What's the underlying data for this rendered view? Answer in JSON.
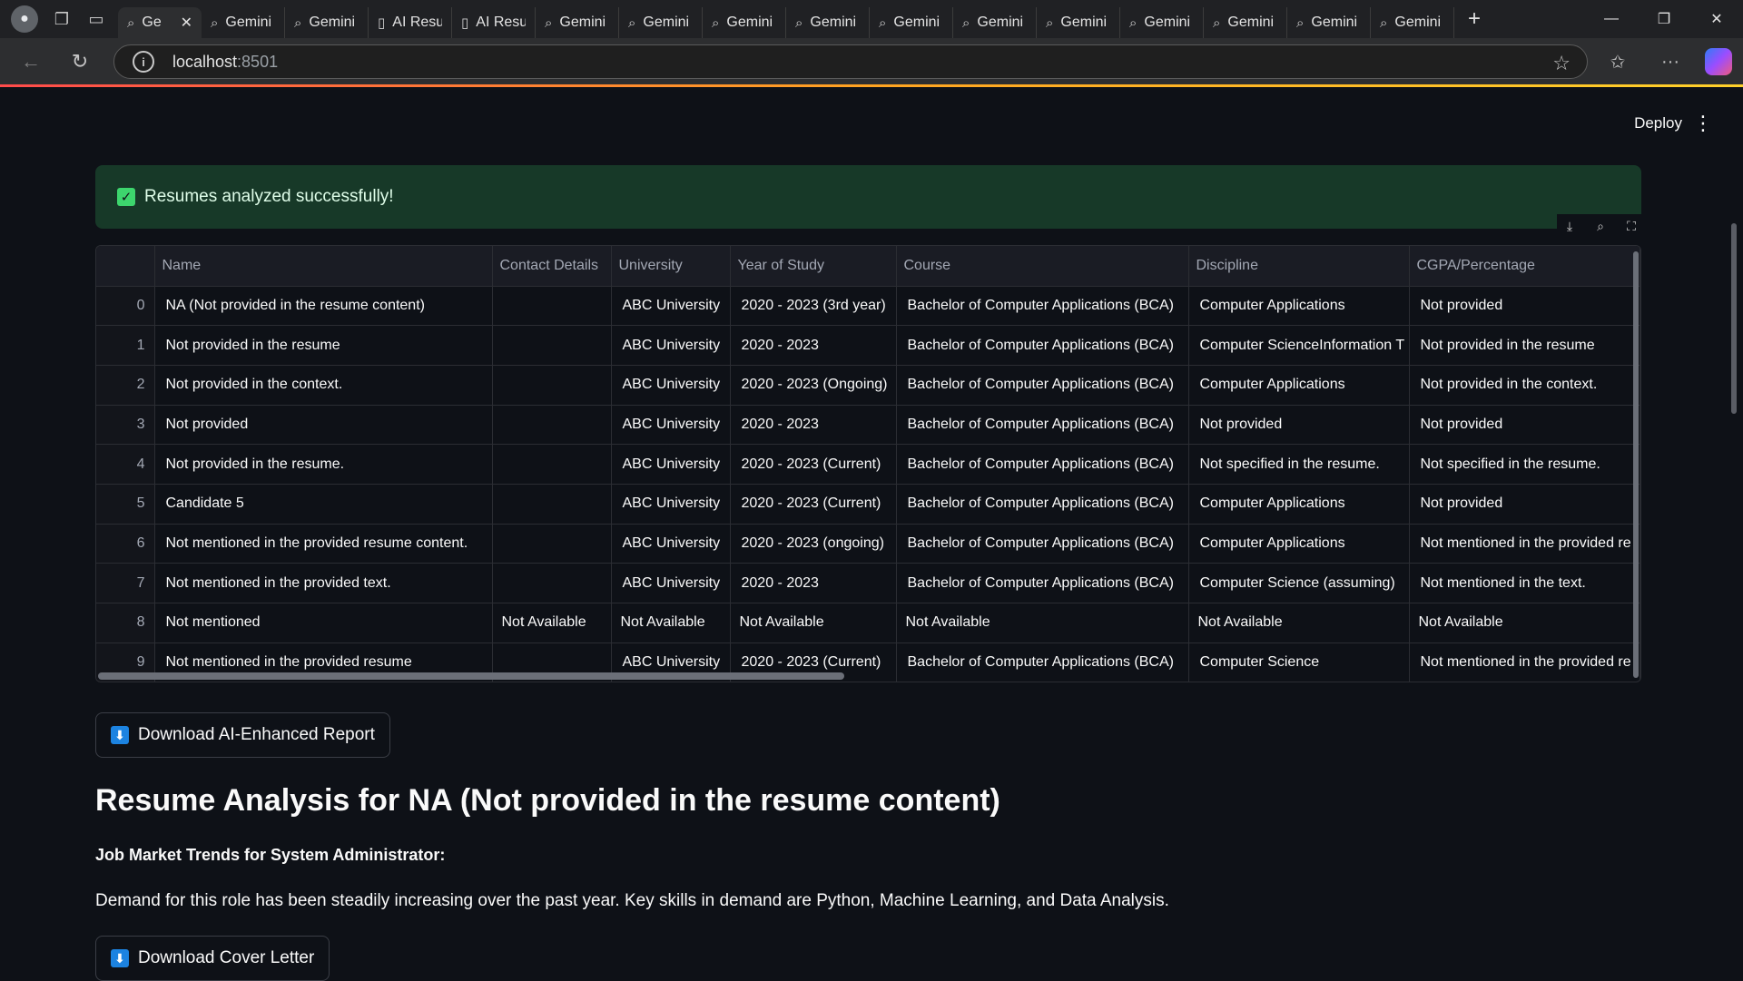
{
  "browser": {
    "tabs": [
      {
        "label": "Ge",
        "icon": "search-icon",
        "active": true
      },
      {
        "label": "Gemini",
        "icon": "search-icon"
      },
      {
        "label": "Gemini",
        "icon": "search-icon"
      },
      {
        "label": "AI Resu",
        "icon": "document-icon"
      },
      {
        "label": "AI Resu",
        "icon": "document-icon"
      },
      {
        "label": "Gemini",
        "icon": "search-icon"
      },
      {
        "label": "Gemini",
        "icon": "search-icon"
      },
      {
        "label": "Gemini",
        "icon": "search-icon"
      },
      {
        "label": "Gemini",
        "icon": "search-icon"
      },
      {
        "label": "Gemini",
        "icon": "search-icon"
      },
      {
        "label": "Gemini",
        "icon": "search-icon"
      },
      {
        "label": "Gemini",
        "icon": "search-icon"
      },
      {
        "label": "Gemini",
        "icon": "search-icon"
      },
      {
        "label": "Gemini",
        "icon": "search-icon"
      },
      {
        "label": "Gemini",
        "icon": "search-icon"
      },
      {
        "label": "Gemini",
        "icon": "search-icon"
      }
    ],
    "url_host": "localhost",
    "url_port": ":8501"
  },
  "app": {
    "deploy_label": "Deploy",
    "alert_text": "Resumes analyzed successfully!",
    "table": {
      "columns": [
        "",
        "Name",
        "Contact Details",
        "University",
        "Year of Study",
        "Course",
        "Discipline",
        "CGPA/Percentage"
      ],
      "rows": [
        [
          "0",
          "NA (Not provided in the resume content)",
          "",
          "ABC University",
          "2020 - 2023 (3rd year)",
          "Bachelor of Computer Applications (BCA)",
          "Computer Applications",
          "Not provided"
        ],
        [
          "1",
          "Not provided in the resume",
          "",
          "ABC University",
          "2020 - 2023",
          "Bachelor of Computer Applications (BCA)",
          "Computer ScienceInformation T",
          "Not provided in the resume"
        ],
        [
          "2",
          "Not provided in the context.",
          "",
          "ABC University",
          "2020 - 2023 (Ongoing)",
          "Bachelor of Computer Applications (BCA)",
          "Computer Applications",
          "Not provided in the context."
        ],
        [
          "3",
          "Not provided",
          "",
          "ABC University",
          "2020 - 2023",
          "Bachelor of Computer Applications (BCA)",
          "Not provided",
          "Not provided"
        ],
        [
          "4",
          "Not provided in the resume.",
          "",
          "ABC University",
          "2020 - 2023 (Current)",
          "Bachelor of Computer Applications (BCA)",
          "Not specified in the resume.",
          "Not specified in the resume."
        ],
        [
          "5",
          "Candidate 5",
          "",
          "ABC University",
          "2020 - 2023 (Current)",
          "Bachelor of Computer Applications (BCA)",
          "Computer Applications",
          "Not provided"
        ],
        [
          "6",
          "Not mentioned in the provided resume content.",
          "",
          "ABC University",
          "2020 - 2023 (ongoing)",
          "Bachelor of Computer Applications (BCA)",
          "Computer Applications",
          "Not mentioned in the provided re"
        ],
        [
          "7",
          "Not mentioned in the provided text.",
          "",
          "ABC University",
          "2020 - 2023",
          "Bachelor of Computer Applications (BCA)",
          "Computer Science (assuming)",
          "Not mentioned in the text."
        ],
        [
          "8",
          "Not mentioned",
          "Not Available",
          "Not Available",
          "Not Available",
          "Not Available",
          "Not Available",
          "Not Available"
        ],
        [
          "9",
          "Not mentioned in the provided resume",
          "",
          "ABC University",
          "2020 - 2023 (Current)",
          "Bachelor of Computer Applications (BCA)",
          "Computer Science",
          "Not mentioned in the provided re"
        ]
      ]
    },
    "download_report_label": "Download AI-Enhanced Report",
    "analysis_title": "Resume Analysis for NA (Not provided in the resume content)",
    "trends_heading": "Job Market Trends for System Administrator:",
    "trends_text": "Demand for this role has been steadily increasing over the past year. Key skills in demand are Python, Machine Learning, and Data Analysis.",
    "download_cover_label": "Download Cover Letter"
  }
}
